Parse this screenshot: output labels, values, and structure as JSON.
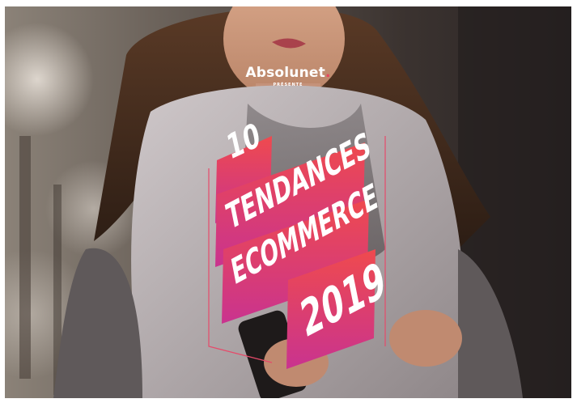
{
  "brand": {
    "name": "Absolunet",
    "dot": ".",
    "subtitle": "PRÉSENTE"
  },
  "title": {
    "line1": "10",
    "line2": "TENDANCES",
    "line3": "ECOMMERCE",
    "line4": "2019"
  },
  "colors": {
    "accent_pink": "#e8455e",
    "accent_magenta": "#d13a8a",
    "scarf": "#b9b2b4"
  }
}
